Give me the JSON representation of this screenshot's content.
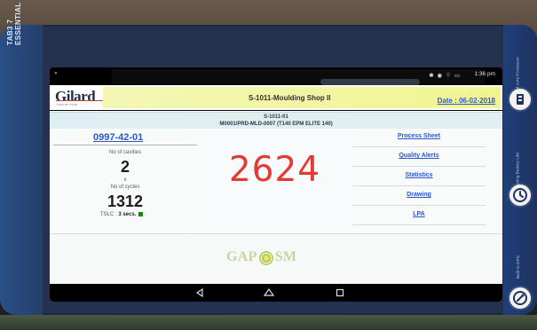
{
  "device": {
    "left_brand_line1": "TAB3 7",
    "left_brand_line2": "ESSENTIAL",
    "right_features": [
      {
        "label": "Dual-core Processor",
        "icon": "processor-icon"
      },
      {
        "label": "Long-lasting Battery Life",
        "icon": "battery-life-icon"
      },
      {
        "label": "Built-in GPS",
        "icon": "gps-icon"
      }
    ]
  },
  "status_bar": {
    "left_icon": "notification-dot-icon",
    "icons": "✱ ◉ ⌔ ▭",
    "time": "1:36 pm"
  },
  "header": {
    "logo_main": "Gilard",
    "logo_tagline": "explore more",
    "title": "S-1011-Moulding Shop II",
    "date": "Date : 06-02-2018"
  },
  "machine": {
    "id": "S-1011-01",
    "description": "M0001/PRD-MLD-0007 (T140 EPM ELITE 140)"
  },
  "stats": {
    "part_number": "0997-42-01",
    "cavities_label": "No of cavities",
    "cavities_value": "2",
    "multiply_symbol": "x",
    "cycles_label": "No of cycles",
    "cycles_value": "1312",
    "tslc_label": "TSLC : ",
    "tslc_value": "3 secs.",
    "count_value": "2624"
  },
  "links": [
    {
      "label": "Process Sheet"
    },
    {
      "label": "Quality Alerts"
    },
    {
      "label": "Statistics"
    },
    {
      "label": "Drawing"
    },
    {
      "label": "LPA"
    }
  ],
  "footer": {
    "brand_left": "GAP",
    "brand_right": "SM"
  },
  "navigation": {
    "back_icon": "back-icon",
    "home_icon": "home-icon",
    "recent_icon": "recent-apps-icon"
  },
  "colors": {
    "accent_blue": "#2d56c8",
    "count_red": "#e33b32",
    "header_yellow": "#f0f58e",
    "status_green": "#128b16"
  }
}
